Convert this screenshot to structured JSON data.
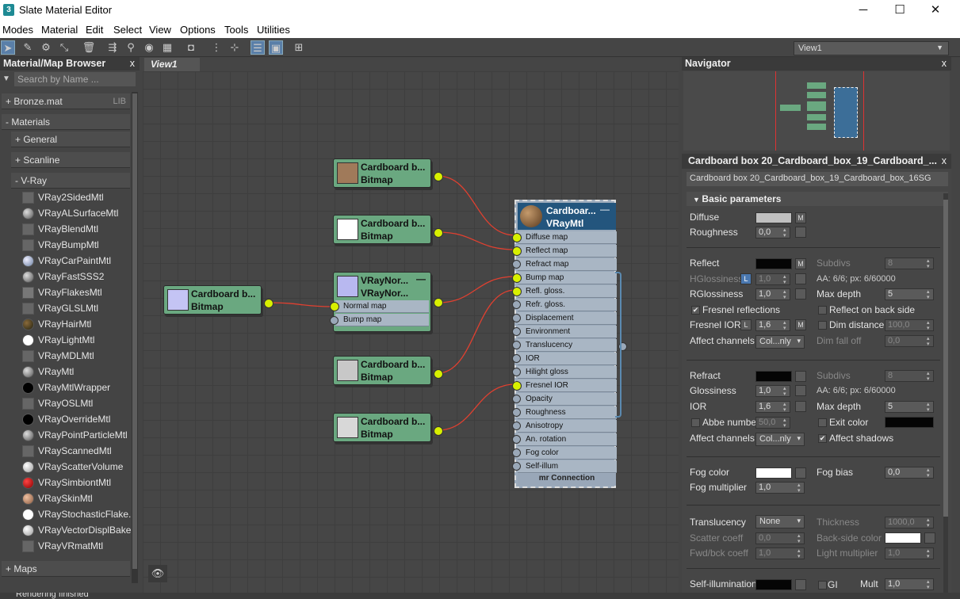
{
  "window": {
    "icon": "3",
    "title": "Slate Material Editor",
    "minimize": "─",
    "maximize": "☐",
    "close": "✕"
  },
  "menu": [
    "Modes",
    "Material",
    "Edit",
    "Select",
    "View",
    "Options",
    "Tools",
    "Utilities"
  ],
  "toolbar": {
    "view_select": "View1"
  },
  "browser": {
    "title": "Material/Map Browser",
    "close": "x",
    "search_placeholder": "Search by Name ...",
    "lib": {
      "label": "+ Bronze.mat",
      "badge": "LIB"
    },
    "materials": "- Materials",
    "general": "+ General",
    "scanline": "+ Scanline",
    "vray": "- V-Ray",
    "items": [
      {
        "name": "VRay2SidedMtl",
        "swatch": "#666666"
      },
      {
        "name": "VRayALSurfaceMtl",
        "swatch": "sphere"
      },
      {
        "name": "VRayBlendMtl",
        "swatch": "#666666"
      },
      {
        "name": "VRayBumpMtl",
        "swatch": "#666666"
      },
      {
        "name": "VRayCarPaintMtl",
        "swatch": "sphereblue"
      },
      {
        "name": "VRayFastSSS2",
        "swatch": "sphere"
      },
      {
        "name": "VRayFlakesMtl",
        "swatch": "#777777"
      },
      {
        "name": "VRayGLSLMtl",
        "swatch": "#666666"
      },
      {
        "name": "VRayHairMtl",
        "swatch": "spheredark"
      },
      {
        "name": "VRayLightMtl",
        "swatch": "white"
      },
      {
        "name": "VRayMDLMtl",
        "swatch": "#666666"
      },
      {
        "name": "VRayMtl",
        "swatch": "sphere"
      },
      {
        "name": "VRayMtlWrapper",
        "swatch": "black"
      },
      {
        "name": "VRayOSLMtl",
        "swatch": "#666666"
      },
      {
        "name": "VRayOverrideMtl",
        "swatch": "black"
      },
      {
        "name": "VRayPointParticleMtl",
        "swatch": "sphere"
      },
      {
        "name": "VRayScannedMtl",
        "swatch": "#666666"
      },
      {
        "name": "VRayScatterVolume",
        "swatch": "spherelight"
      },
      {
        "name": "VRaySimbiontMtl",
        "swatch": "red"
      },
      {
        "name": "VRaySkinMtl",
        "swatch": "sphereskin"
      },
      {
        "name": "VRayStochasticFlake...",
        "swatch": "white"
      },
      {
        "name": "VRayVectorDisplBake",
        "swatch": "spherelight"
      },
      {
        "name": "VRayVRmatMtl",
        "swatch": "#666666"
      }
    ],
    "maps": "+ Maps"
  },
  "view": {
    "tab": "View1",
    "binoculars": "⛶"
  },
  "nodes": [
    {
      "title": "Cardboard b...",
      "type": "Bitmap",
      "thumb": "#a07a5a"
    },
    {
      "title": "Cardboard b...",
      "type": "Bitmap",
      "thumb": "#ffffff"
    },
    {
      "title": "VRayNor...",
      "type": "VRayNor...",
      "thumb": "#b8b8f0",
      "slots": [
        "Normal map",
        "Bump map"
      ]
    },
    {
      "title": "Cardboard b...",
      "type": "Bitmap",
      "thumb": "#c8c8c8"
    },
    {
      "title": "Cardboard b...",
      "type": "Bitmap",
      "thumb": "#d8d8d8"
    },
    {
      "title": "Cardboard b...",
      "type": "Bitmap",
      "thumb": "#c4c4f4"
    }
  ],
  "vray_node": {
    "title": "Cardboar...",
    "type": "VRayMtl",
    "collapse": "—",
    "footer": "mr Connection",
    "slots": [
      "Diffuse map",
      "Reflect map",
      "Refract map",
      "Bump map",
      "Refl. gloss.",
      "Refr. gloss.",
      "Displacement",
      "Environment",
      "Translucency",
      "IOR",
      "Hilight gloss",
      "Fresnel IOR",
      "Opacity",
      "Roughness",
      "Anisotropy",
      "An. rotation",
      "Fog color",
      "Self-illum"
    ]
  },
  "navigator": {
    "title": "Navigator",
    "close": "x"
  },
  "params": {
    "title": "Cardboard box 20_Cardboard_box_19_Cardboard_...",
    "close": "x",
    "name": "Cardboard box 20_Cardboard_box_19_Cardboard_box_16SG",
    "rollout": "Basic parameters",
    "diffuse": "Diffuse",
    "roughness": "Roughness",
    "roughness_val": "0,0",
    "reflect": "Reflect",
    "subdivs": "Subdivs",
    "subdivs_val": "8",
    "hgloss": "HGlossiness",
    "hgloss_val": "1,0",
    "aa": "AA: 6/6; px: 6/60000",
    "rgloss": "RGlossiness",
    "rgloss_val": "1,0",
    "maxdepth": "Max depth",
    "maxdepth_val": "5",
    "fresnel": "Fresnel reflections",
    "reflect_back": "Reflect on back side",
    "fresnel_ior": "Fresnel IOR",
    "fresnel_ior_val": "1,6",
    "dim_distance": "Dim distance",
    "dim_val": "100,0",
    "affect": "Affect channels",
    "affect_val": "Col...nly",
    "dim_falloff": "Dim fall off",
    "dim_falloff_val": "0,0",
    "refract": "Refract",
    "r_subdivs_val": "8",
    "glossiness": "Glossiness",
    "gloss_val": "1,0",
    "aa2": "AA: 6/6; px: 6/60000",
    "ior": "IOR",
    "ior_val": "1,6",
    "r_maxdepth_val": "5",
    "abbe": "Abbe number",
    "abbe_val": "50,0",
    "exit_color": "Exit color",
    "affect_shadows": "Affect shadows",
    "fog_color": "Fog color",
    "fog_bias": "Fog bias",
    "fog_bias_val": "0,0",
    "fog_mult": "Fog multiplier",
    "fog_mult_val": "1,0",
    "translucency": "Translucency",
    "transl_val": "None",
    "thickness": "Thickness",
    "thickness_val": "1000,0",
    "scatter": "Scatter coeff",
    "scatter_val": "0,0",
    "backside": "Back-side color",
    "fwdbck": "Fwd/bck coeff",
    "fwdbck_val": "1,0",
    "lightmult": "Light multiplier",
    "lightmult_val": "1,0",
    "selfillum": "Self-illumination",
    "gi": "GI",
    "mult": "Mult",
    "mult_val": "1,0",
    "m": "M",
    "l": "L",
    "check": "✔"
  },
  "status": "Rendering finished"
}
